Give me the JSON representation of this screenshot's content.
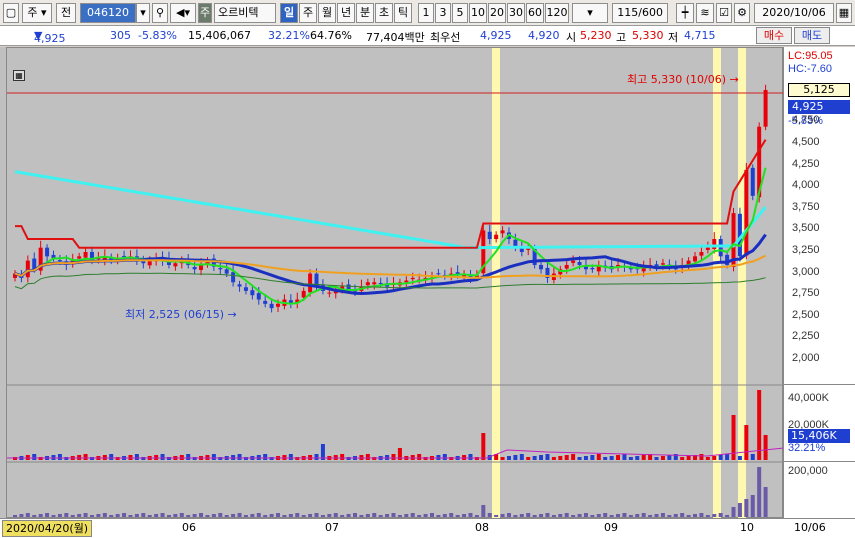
{
  "toolbar": {
    "market": "주",
    "prev": "전",
    "code": "046120",
    "company_badge": "주",
    "company": "오르비텍",
    "periods": [
      "일",
      "주",
      "월",
      "년",
      "분",
      "초",
      "틱"
    ],
    "active_period": "일",
    "minutes": [
      "1",
      "3",
      "5",
      "10",
      "20",
      "30",
      "60",
      "120"
    ],
    "page_count": "115/600",
    "date": "2020/10/06"
  },
  "info": {
    "price": "4,925",
    "change": "305",
    "change_pct": "-5.83%",
    "volume": "15,406,067",
    "vol_ratio": "32.21%",
    "turnover_pct": "64.76%",
    "amount": "77,404백만",
    "best_ask_label": "최우선",
    "ask": "4,925",
    "bid": "4,920",
    "open_label": "시",
    "open": "5,230",
    "high_label": "고",
    "high": "5,330",
    "low_label": "저",
    "low": "4,715",
    "buy": "매수",
    "sell": "매도"
  },
  "annotations": {
    "high_note": "최고 5,330 (10/06)",
    "low_note": "최저 2,525 (06/15)",
    "lc": "LC:95.05",
    "hc": "HC:-7.60",
    "price_label": "5,125",
    "current": "4,925",
    "current_pct": "-5.83%",
    "vol_label": "15,406K",
    "vol_pct": "32.21%"
  },
  "colors": {
    "up": "#e8000b",
    "down": "#1f3fd0",
    "ma_cyan": "#3ef2f2",
    "ma_red": "#e01010",
    "ma_blue": "#1a2fc0",
    "ma_green": "#22e022",
    "ma_orange": "#f0a020",
    "highlight": "#fff8b0"
  },
  "chart_data": {
    "type": "candlestick",
    "x_labels": [
      "06",
      "07",
      "08",
      "09",
      "10"
    ],
    "start_label": "2020/04/20(월)",
    "end_label": "10/06",
    "y_ticks": [
      2000,
      2250,
      2500,
      2750,
      3000,
      3250,
      3500,
      3750,
      4000,
      4250,
      4500,
      4750
    ],
    "volume_ticks": [
      "40,000K",
      "20,000K"
    ],
    "amount_ticks": [
      "200,000"
    ],
    "high": 5330,
    "low": 2525,
    "last": 4925
  }
}
